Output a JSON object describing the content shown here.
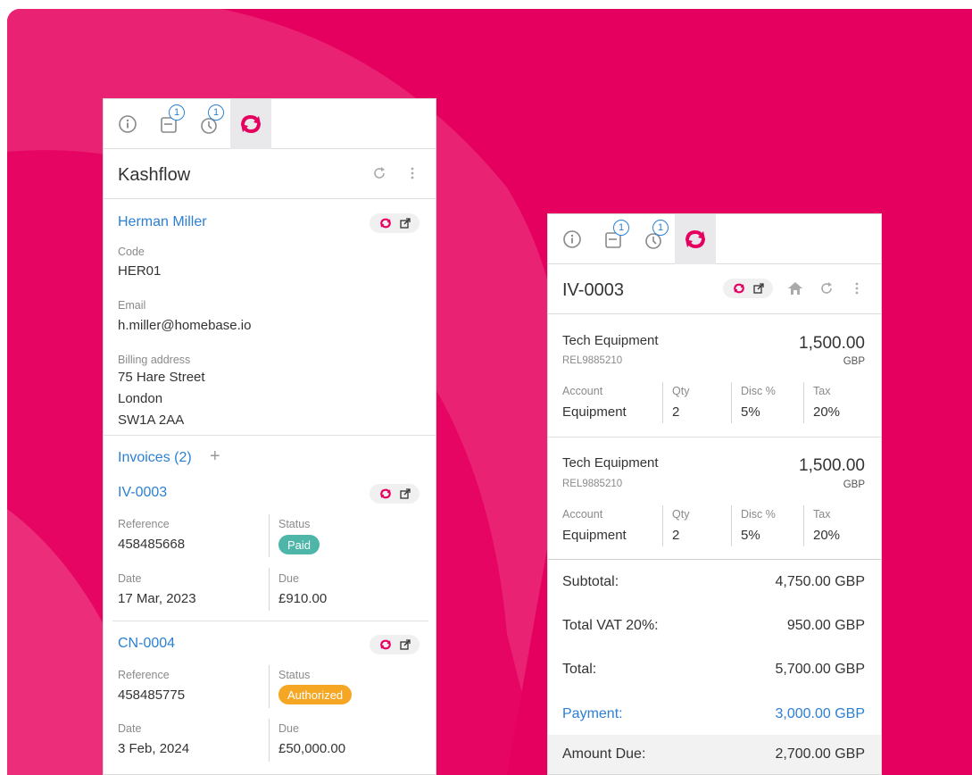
{
  "theme": {
    "brand": "#e5005f",
    "link": "#2c80d3",
    "paid": "#4db6a8",
    "authorized": "#f5a623"
  },
  "tabs": [
    {
      "icon": "info-icon"
    },
    {
      "icon": "calendar-icon",
      "badge": "1"
    },
    {
      "icon": "clock-icon",
      "badge": "1"
    },
    {
      "icon": "sync-icon",
      "active": true
    }
  ],
  "contact_panel": {
    "title": "Kashflow",
    "contact": {
      "name": "Herman Miller",
      "code_label": "Code",
      "code": "HER01",
      "email_label": "Email",
      "email": "h.miller@homebase.io",
      "billing_label": "Billing address",
      "billing_lines": [
        "75 Hare Street",
        "London",
        "SW1A 2AA"
      ]
    },
    "invoices_heading": "Invoices (2)",
    "add_glyph": "+",
    "invoices": [
      {
        "number": "IV-0003",
        "reference_label": "Reference",
        "reference": "458485668",
        "status_label": "Status",
        "status": "Paid",
        "date_label": "Date",
        "date": "17 Mar, 2023",
        "due_label": "Due",
        "due": "£910.00"
      },
      {
        "number": "CN-0004",
        "reference_label": "Reference",
        "reference": "458485775",
        "status_label": "Status",
        "status": "Authorized",
        "date_label": "Date",
        "date": "3 Feb, 2024",
        "due_label": "Due",
        "due": "£50,000.00"
      }
    ]
  },
  "invoice_panel": {
    "title": "IV-0003",
    "lines": [
      {
        "name": "Tech Equipment",
        "sku": "REL9885210",
        "amount": "1,500.00",
        "currency": "GBP",
        "account_label": "Account",
        "account": "Equipment",
        "qty_label": "Qty",
        "qty": "2",
        "disc_label": "Disc %",
        "disc": "5%",
        "tax_label": "Tax",
        "tax": "20%"
      },
      {
        "name": "Tech Equipment",
        "sku": "REL9885210",
        "amount": "1,500.00",
        "currency": "GBP",
        "account_label": "Account",
        "account": "Equipment",
        "qty_label": "Qty",
        "qty": "2",
        "disc_label": "Disc %",
        "disc": "5%",
        "tax_label": "Tax",
        "tax": "20%"
      }
    ],
    "totals": {
      "subtotal_label": "Subtotal:",
      "subtotal": "4,750.00 GBP",
      "vat_label": "Total VAT 20%:",
      "vat": "950.00 GBP",
      "total_label": "Total:",
      "total": "5,700.00 GBP",
      "payment_label": "Payment:",
      "payment": "3,000.00 GBP",
      "due_label": "Amount Due:",
      "due": "2,700.00 GBP"
    }
  }
}
